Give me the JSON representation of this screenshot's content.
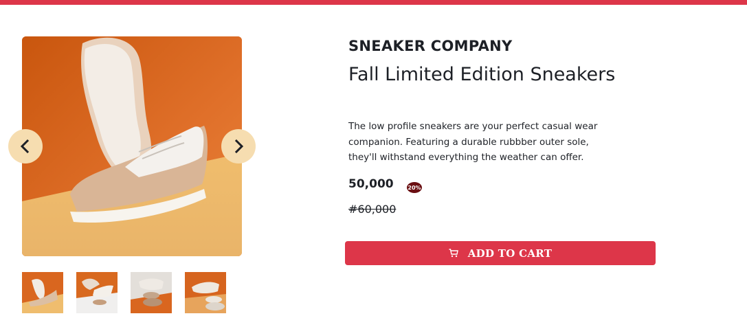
{
  "product": {
    "brand": "SNEAKER COMPANY",
    "title": "Fall Limited Edition Sneakers",
    "description": "The low profile sneakers are your perfect casual wear companion. Featuring a durable rubbber outer sole, they'll withstand everything the weather can offer.",
    "price": "50,000",
    "discount": "20%",
    "old_price": "#60,000"
  },
  "gallery": {
    "prev_icon": "chevron-left-icon",
    "next_icon": "chevron-right-icon",
    "thumbnail_count": 4
  },
  "cart": {
    "icon": "cart-icon",
    "label": "ADD TO CART"
  },
  "colors": {
    "accent": "#dd3649",
    "nav_button": "#f6ddb0",
    "badge": "#6b0f12",
    "text": "#1d2026"
  }
}
